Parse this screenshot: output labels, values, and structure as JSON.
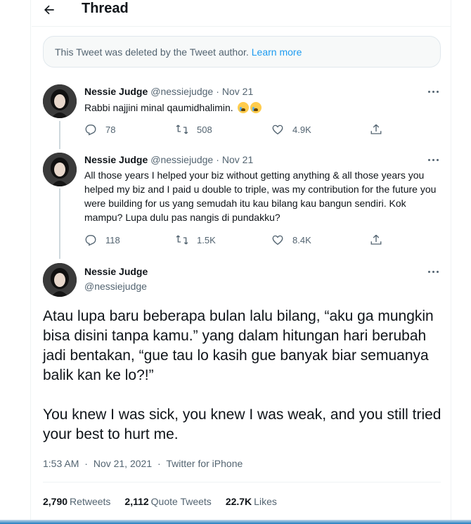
{
  "header": {
    "title": "Thread"
  },
  "deleted_notice": {
    "text": "This Tweet was deleted by the Tweet author.",
    "link": "Learn more"
  },
  "tweets": [
    {
      "name": "Nessie Judge",
      "handle": "@nessiejudge",
      "separator": "·",
      "date": "Nov 21",
      "text": "Rabbi najjini minal qaumidhalimin.",
      "emojis": [
        "loudly-crying-face",
        "loudly-crying-face"
      ],
      "replies": "78",
      "retweets": "508",
      "likes": "4.9K"
    },
    {
      "name": "Nessie Judge",
      "handle": "@nessiejudge",
      "separator": "·",
      "date": "Nov 21",
      "text": "All those years I helped your biz without getting anything & all those years you helped my biz and I paid u double to triple, was my contribution for the future you were building for us yang semudah itu kau bilang kau bangun sendiri. Kok mampu? Lupa dulu pas nangis di pundakku?",
      "replies": "118",
      "retweets": "1.5K",
      "likes": "8.4K"
    }
  ],
  "main_tweet": {
    "name": "Nessie Judge",
    "handle": "@nessiejudge",
    "paragraph1": "Atau lupa baru beberapa bulan lalu bilang, “aku ga mungkin bisa disini tanpa kamu.” yang dalam hitungan hari berubah jadi bentakan, “gue tau lo kasih gue banyak biar semuanya balik kan ke lo?!”",
    "paragraph2": "You knew I was sick, you knew I was weak, and you still tried your best to hurt me.",
    "time": "1:53 AM",
    "date": "Nov 21, 2021",
    "source": "Twitter for iPhone",
    "separator": "·",
    "retweets_count": "2,790",
    "retweets_label": "Retweets",
    "quotes_count": "2,112",
    "quotes_label": "Quote Tweets",
    "likes_count": "22.7K",
    "likes_label": "Likes"
  },
  "colors": {
    "accent": "#1d9bf0",
    "secondary_text": "#536471",
    "primary_text": "#0f1419"
  }
}
